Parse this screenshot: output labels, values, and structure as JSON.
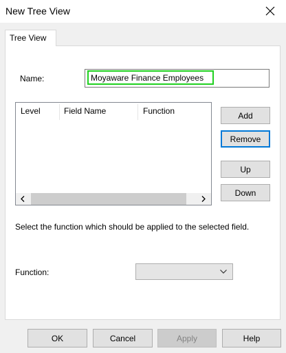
{
  "window": {
    "title": "New Tree View"
  },
  "tabs": [
    {
      "label": "Tree View"
    }
  ],
  "form": {
    "name_label": "Name:",
    "name_value": "Moyaware Finance Employees",
    "columns": [
      "Level",
      "Field Name",
      "Function"
    ],
    "rows": [],
    "instruction": "Select the function which should be applied to the selected field.",
    "function_label": "Function:",
    "function_value": ""
  },
  "side_buttons": {
    "add": "Add",
    "remove": "Remove",
    "up": "Up",
    "down": "Down"
  },
  "dialog_buttons": {
    "ok": "OK",
    "cancel": "Cancel",
    "apply": "Apply",
    "help": "Help"
  },
  "colors": {
    "highlight_border": "#1fd01f",
    "focus_border": "#0078d7"
  }
}
